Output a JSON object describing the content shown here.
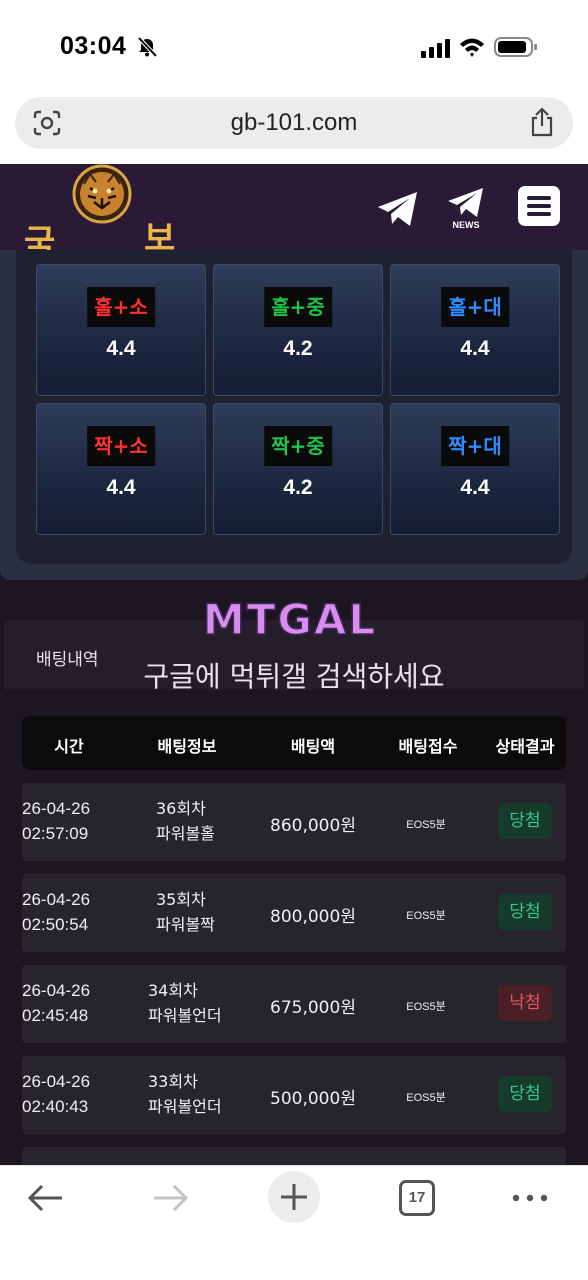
{
  "status": {
    "time": "03:04"
  },
  "browser": {
    "url": "gb-101.com",
    "tab_count": "17"
  },
  "site": {
    "logo_left": "국",
    "logo_right": "보",
    "news_label": "NEWS"
  },
  "bet_options": [
    {
      "label": "홀+소",
      "odds": "4.4",
      "color": "#ff3030"
    },
    {
      "label": "홀+중",
      "odds": "4.2",
      "color": "#22c24a"
    },
    {
      "label": "홀+대",
      "odds": "4.4",
      "color": "#2f8cff"
    },
    {
      "label": "짝+소",
      "odds": "4.4",
      "color": "#ff3030"
    },
    {
      "label": "짝+중",
      "odds": "4.2",
      "color": "#22c24a"
    },
    {
      "label": "짝+대",
      "odds": "4.4",
      "color": "#2f8cff"
    }
  ],
  "watermark": {
    "logo": "MTGAL",
    "text": "구글에 먹튀갤 검색하세요"
  },
  "history": {
    "tab_label": "배팅내역",
    "headers": [
      "시간",
      "배팅정보",
      "배팅액",
      "배팅접수",
      "상태결과"
    ],
    "rows": [
      {
        "date": "26-04-26",
        "time": "02:57:09",
        "round": "36회차",
        "pick": "파워볼홀",
        "amount": "860,000원",
        "type": "EOS5분",
        "result": "당첨"
      },
      {
        "date": "26-04-26",
        "time": "02:50:54",
        "round": "35회차",
        "pick": "파워볼짝",
        "amount": "800,000원",
        "type": "EOS5분",
        "result": "당첨"
      },
      {
        "date": "26-04-26",
        "time": "02:45:48",
        "round": "34회차",
        "pick": "파워볼언더",
        "amount": "675,000원",
        "type": "EOS5분",
        "result": "낙첨"
      },
      {
        "date": "26-04-26",
        "time": "02:40:43",
        "round": "33회차",
        "pick": "파워볼언더",
        "amount": "500,000원",
        "type": "EOS5분",
        "result": "당첨"
      }
    ]
  }
}
